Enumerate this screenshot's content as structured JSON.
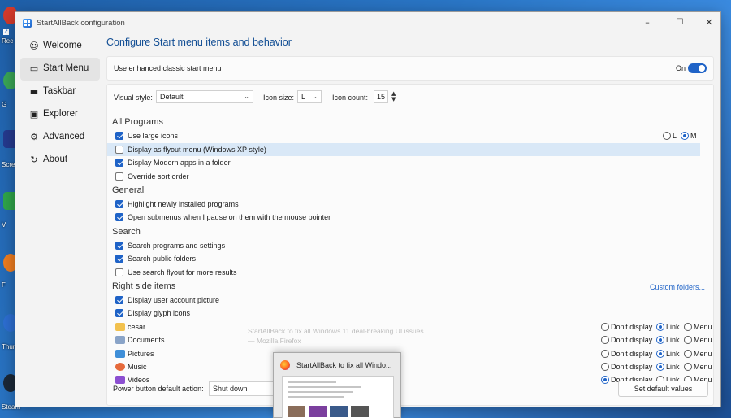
{
  "desktop": {
    "labels": [
      "Rec",
      "G",
      "Scre",
      "V",
      "F",
      "Thun",
      "Steam"
    ]
  },
  "window": {
    "title": "StartAllBack configuration",
    "minimize": "–",
    "maximize": "☐",
    "close": "✕"
  },
  "sidebar": {
    "items": [
      {
        "label": "Welcome",
        "icon": "☺"
      },
      {
        "label": "Start Menu",
        "icon": "▭"
      },
      {
        "label": "Taskbar",
        "icon": "▬"
      },
      {
        "label": "Explorer",
        "icon": "▣"
      },
      {
        "label": "Advanced",
        "icon": "⚙"
      },
      {
        "label": "About",
        "icon": "↻"
      }
    ],
    "active_index": 1
  },
  "page_title": "Configure Start menu items and behavior",
  "enhanced": {
    "label": "Use enhanced classic start menu",
    "state": "On"
  },
  "controls": {
    "visual_style_label": "Visual style:",
    "visual_style_value": "Default",
    "icon_size_label": "Icon size:",
    "icon_size_value": "L",
    "icon_count_label": "Icon count:",
    "icon_count_value": "15"
  },
  "sections": {
    "all_programs": "All Programs",
    "general": "General",
    "search": "Search",
    "right_side": "Right side items"
  },
  "options": {
    "large_icons": "Use large icons",
    "flyout": "Display as flyout menu (Windows XP style)",
    "modern_apps": "Display Modern apps in a folder",
    "sort_order": "Override sort order",
    "highlight": "Highlight newly installed programs",
    "submenus": "Open submenus when I pause on them with the mouse pointer",
    "search_programs": "Search programs and settings",
    "search_folders": "Search public folders",
    "search_flyout": "Use search flyout for more results",
    "user_picture": "Display user account picture",
    "glyph_icons": "Display glyph icons"
  },
  "size_radio": {
    "l": "L",
    "m": "M"
  },
  "custom_folders": "Custom folders...",
  "right_items": [
    {
      "name": "cesar",
      "selected": "link"
    },
    {
      "name": "Documents",
      "selected": "link"
    },
    {
      "name": "Pictures",
      "selected": "link"
    },
    {
      "name": "Music",
      "selected": "link"
    },
    {
      "name": "Videos",
      "selected": "dont"
    }
  ],
  "radio_labels": {
    "dont": "Don't display",
    "link": "Link",
    "menu": "Menu"
  },
  "power": {
    "label": "Power button default action:",
    "value": "Shut down"
  },
  "set_default": "Set default values",
  "ghost_line1": "StartAllBack to fix all Windows 11 deal-breaking UI issues",
  "ghost_line2": "— Mozilla Firefox",
  "thumbnail_title": "StartAllBack to fix all Windo...",
  "colors": {
    "accent": "#1f63c7",
    "title": "#124e94",
    "highlight": "#d9e8f7"
  }
}
